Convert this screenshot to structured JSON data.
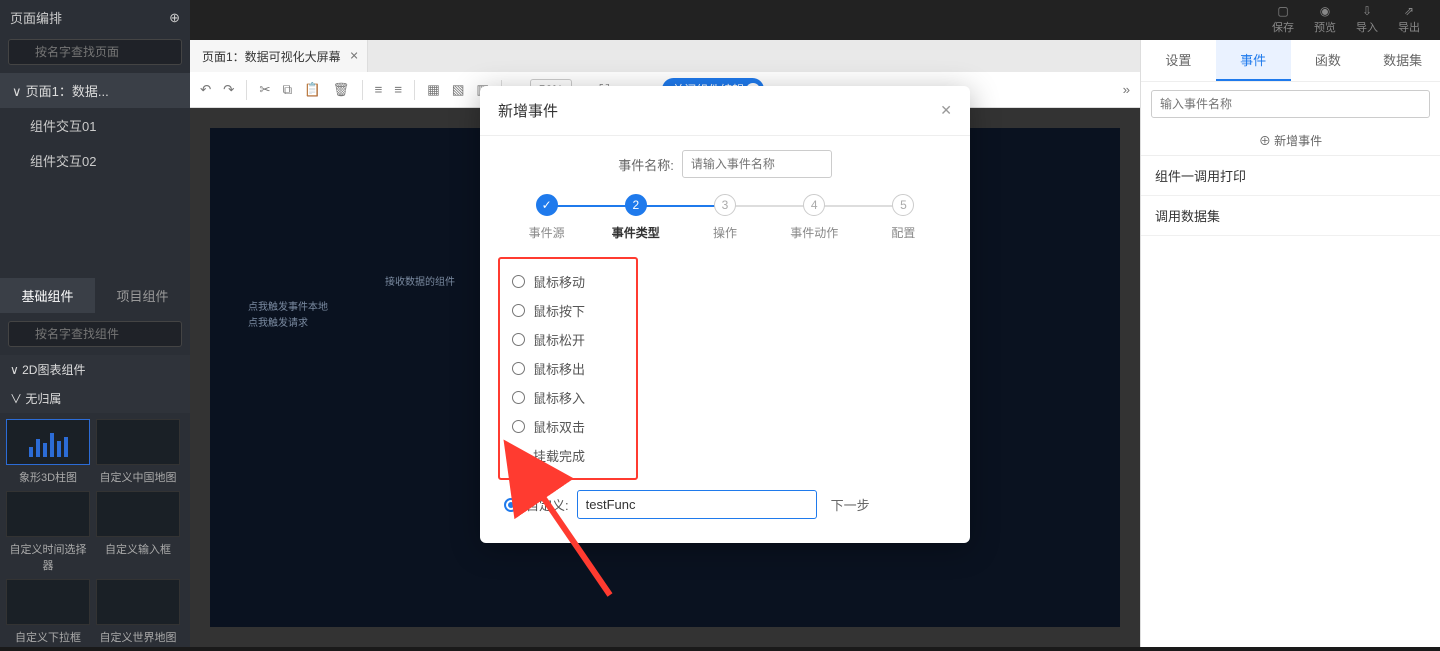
{
  "top_actions": {
    "save": "保存",
    "preview": "预览",
    "import": "导入",
    "export": "导出"
  },
  "left": {
    "header": "页面编排",
    "search_placeholder": "按名字查找页面",
    "pages": {
      "root": "页面1：数据...",
      "children": [
        "组件交互01",
        "组件交互02"
      ]
    },
    "tabs": {
      "basic": "基础组件",
      "project": "项目组件"
    },
    "comp_search_placeholder": "按名字查找组件",
    "groups": {
      "g1": "2D图表组件",
      "g2": "无归属"
    },
    "tiles": {
      "t1": "象形3D柱图",
      "t2": "自定义中国地图",
      "t3": "自定义时间选择器",
      "t4": "自定义输入框",
      "t5": "自定义下拉框",
      "t6": "自定义世界地图"
    }
  },
  "center": {
    "page_tab": "页面1：数据可视化大屏幕",
    "zoom": "56%",
    "close_edit": "关闭组件编辑",
    "canvas_txt1": "接收数据的组件",
    "canvas_txt2": "点我触发事件本地",
    "canvas_txt3": "点我触发请求"
  },
  "right": {
    "tabs": {
      "settings": "设置",
      "events": "事件",
      "functions": "函数",
      "datasets": "数据集"
    },
    "search_placeholder": "输入事件名称",
    "add_event": "⊕ 新增事件",
    "items": {
      "i1": "组件一调用打印",
      "i2": "调用数据集"
    }
  },
  "modal": {
    "title": "新增事件",
    "name_label": "事件名称:",
    "name_placeholder": "请输入事件名称",
    "steps": {
      "s1": "事件源",
      "s2": "事件类型",
      "s3": "操作",
      "s4": "事件动作",
      "s5": "配置",
      "n2": "2",
      "n3": "3",
      "n4": "4",
      "n5": "5"
    },
    "options": {
      "o1": "鼠标移动",
      "o2": "鼠标按下",
      "o3": "鼠标松开",
      "o4": "鼠标移出",
      "o5": "鼠标移入",
      "o6": "鼠标双击",
      "o7": "挂载完成"
    },
    "custom_label": "自定义:",
    "custom_value": "testFunc",
    "next": "下一步"
  }
}
